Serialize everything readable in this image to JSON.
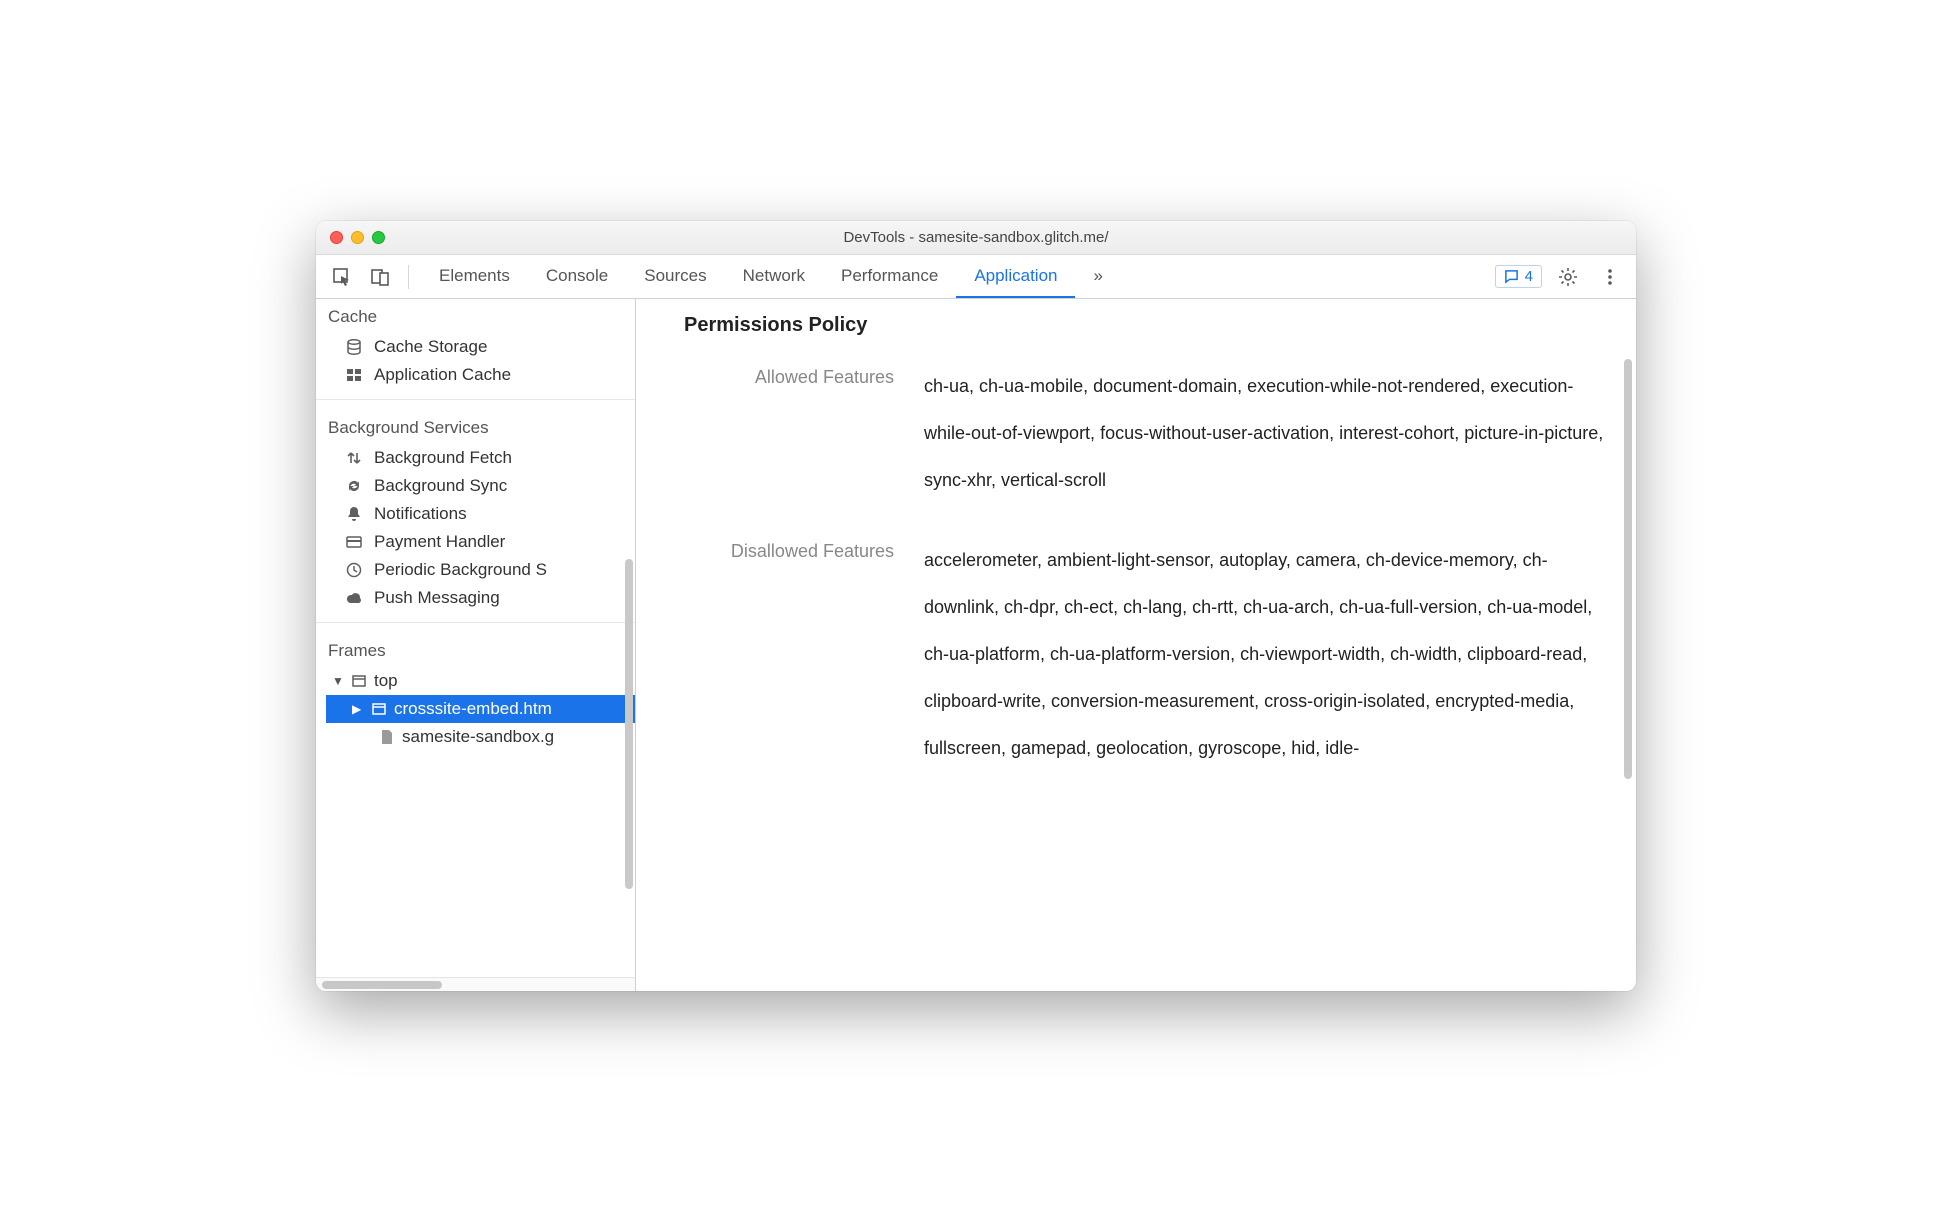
{
  "window": {
    "title": "DevTools - samesite-sandbox.glitch.me/"
  },
  "toolbar": {
    "tabs": [
      "Elements",
      "Console",
      "Sources",
      "Network",
      "Performance",
      "Application"
    ],
    "active_tab_index": 5,
    "more_label": "»",
    "messages_count": "4"
  },
  "sidebar": {
    "groups": [
      {
        "title": "Cache",
        "items": [
          {
            "icon": "database",
            "label": "Cache Storage"
          },
          {
            "icon": "grid",
            "label": "Application Cache"
          }
        ]
      },
      {
        "title": "Background Services",
        "items": [
          {
            "icon": "updown",
            "label": "Background Fetch"
          },
          {
            "icon": "sync",
            "label": "Background Sync"
          },
          {
            "icon": "bell",
            "label": "Notifications"
          },
          {
            "icon": "card",
            "label": "Payment Handler"
          },
          {
            "icon": "clock",
            "label": "Periodic Background Sync"
          },
          {
            "icon": "cloud",
            "label": "Push Messaging"
          }
        ]
      }
    ],
    "frames_title": "Frames",
    "frames": {
      "top": "top",
      "children": [
        {
          "icon": "frame",
          "label": "crosssite-embed.html",
          "selected": true
        },
        {
          "icon": "file",
          "label": "samesite-sandbox.glitch.me",
          "selected": false
        }
      ]
    }
  },
  "main": {
    "section_title": "Permissions Policy",
    "rows": [
      {
        "label": "Allowed Features",
        "value": "ch-ua, ch-ua-mobile, document-domain, execution-while-not-rendered, execution-while-out-of-viewport, focus-without-user-activation, interest-cohort, picture-in-picture, sync-xhr, vertical-scroll"
      },
      {
        "label": "Disallowed Features",
        "value": "accelerometer, ambient-light-sensor, autoplay, camera, ch-device-memory, ch-downlink, ch-dpr, ch-ect, ch-lang, ch-rtt, ch-ua-arch, ch-ua-full-version, ch-ua-model, ch-ua-platform, ch-ua-platform-version, ch-viewport-width, ch-width, clipboard-read, clipboard-write, conversion-measurement, cross-origin-isolated, encrypted-media, fullscreen, gamepad, geolocation, gyroscope, hid, idle-"
      }
    ]
  }
}
